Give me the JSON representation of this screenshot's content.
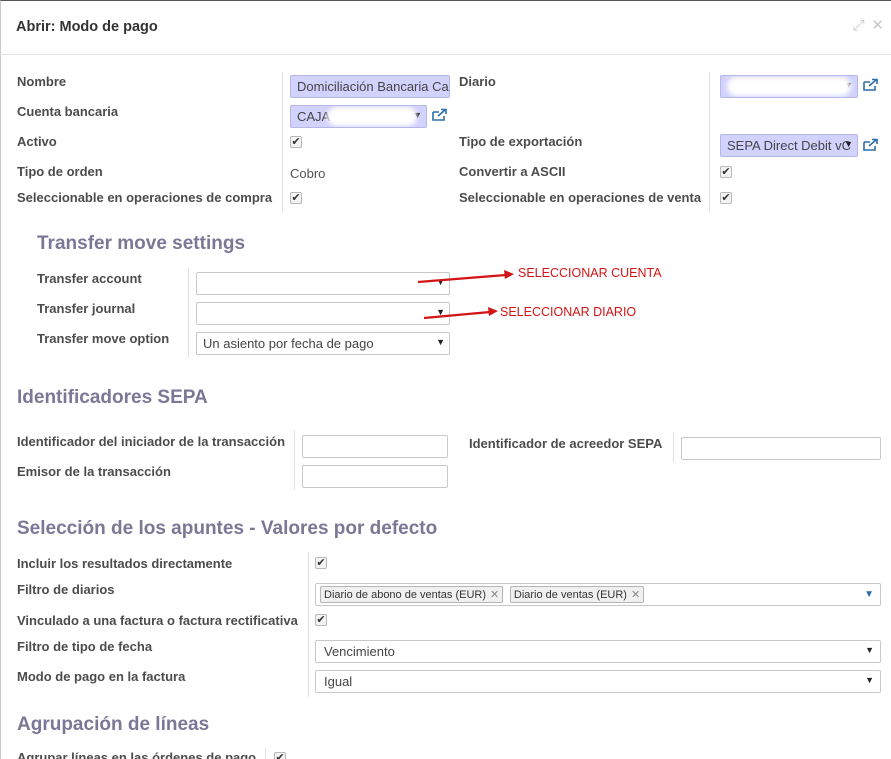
{
  "window": {
    "title": "Abrir: Modo de pago",
    "expand_icon": "expand-icon",
    "close_icon": "close-icon"
  },
  "general": {
    "nombre_label": "Nombre",
    "nombre_value": "Domiciliación Bancaria Ca",
    "diario_label": "Diario",
    "diario_value": "",
    "cuenta_label": "Cuenta bancaria",
    "cuenta_value": "CAJA",
    "activo_label": "Activo",
    "tipo_exportacion_label": "Tipo de exportación",
    "tipo_exportacion_value": "SEPA Direct Debit vC",
    "tipo_orden_label": "Tipo de orden",
    "tipo_orden_value": "Cobro",
    "convertir_ascii_label": "Convertir a ASCII",
    "sel_compra_label": "Seleccionable en operaciones de compra",
    "sel_venta_label": "Seleccionable en operaciones de venta"
  },
  "transfer": {
    "title": "Transfer move settings",
    "account_label": "Transfer account",
    "account_value": "",
    "journal_label": "Transfer journal",
    "journal_value": "",
    "option_label": "Transfer move option",
    "option_value": "Un asiento por fecha de pago",
    "annotation_account": "SELECCIONAR CUENTA",
    "annotation_journal": "SELECCIONAR DIARIO",
    "annotation_color": "#d31414"
  },
  "sepa": {
    "title": "Identificadores SEPA",
    "iniciador_label": "Identificador del iniciador de la transacción",
    "iniciador_value": "",
    "emisor_label": "Emisor de la transacción",
    "emisor_value": "",
    "acreedor_label": "Identificador de acreedor SEPA",
    "acreedor_value": ""
  },
  "apuntes": {
    "title": "Selección de los apuntes - Valores por defecto",
    "incluir_label": "Incluir los resultados directamente",
    "filtro_diarios_label": "Filtro de diarios",
    "filtro_diarios_tags": [
      "Diario de abono de ventas (EUR)",
      "Diario de ventas (EUR)"
    ],
    "vinculado_label": "Vinculado a una factura o factura rectificativa",
    "filtro_fecha_label": "Filtro de tipo de fecha",
    "filtro_fecha_value": "Vencimiento",
    "modo_pago_label": "Modo de pago en la factura",
    "modo_pago_value": "Igual"
  },
  "agrupacion": {
    "title": "Agrupación de líneas",
    "agrupar_label": "Agrupar líneas en las órdenes de pago"
  },
  "colors": {
    "section_title": "#7b7796",
    "required_field": "#d2d2ff",
    "link_icon": "#2c6ea8"
  }
}
